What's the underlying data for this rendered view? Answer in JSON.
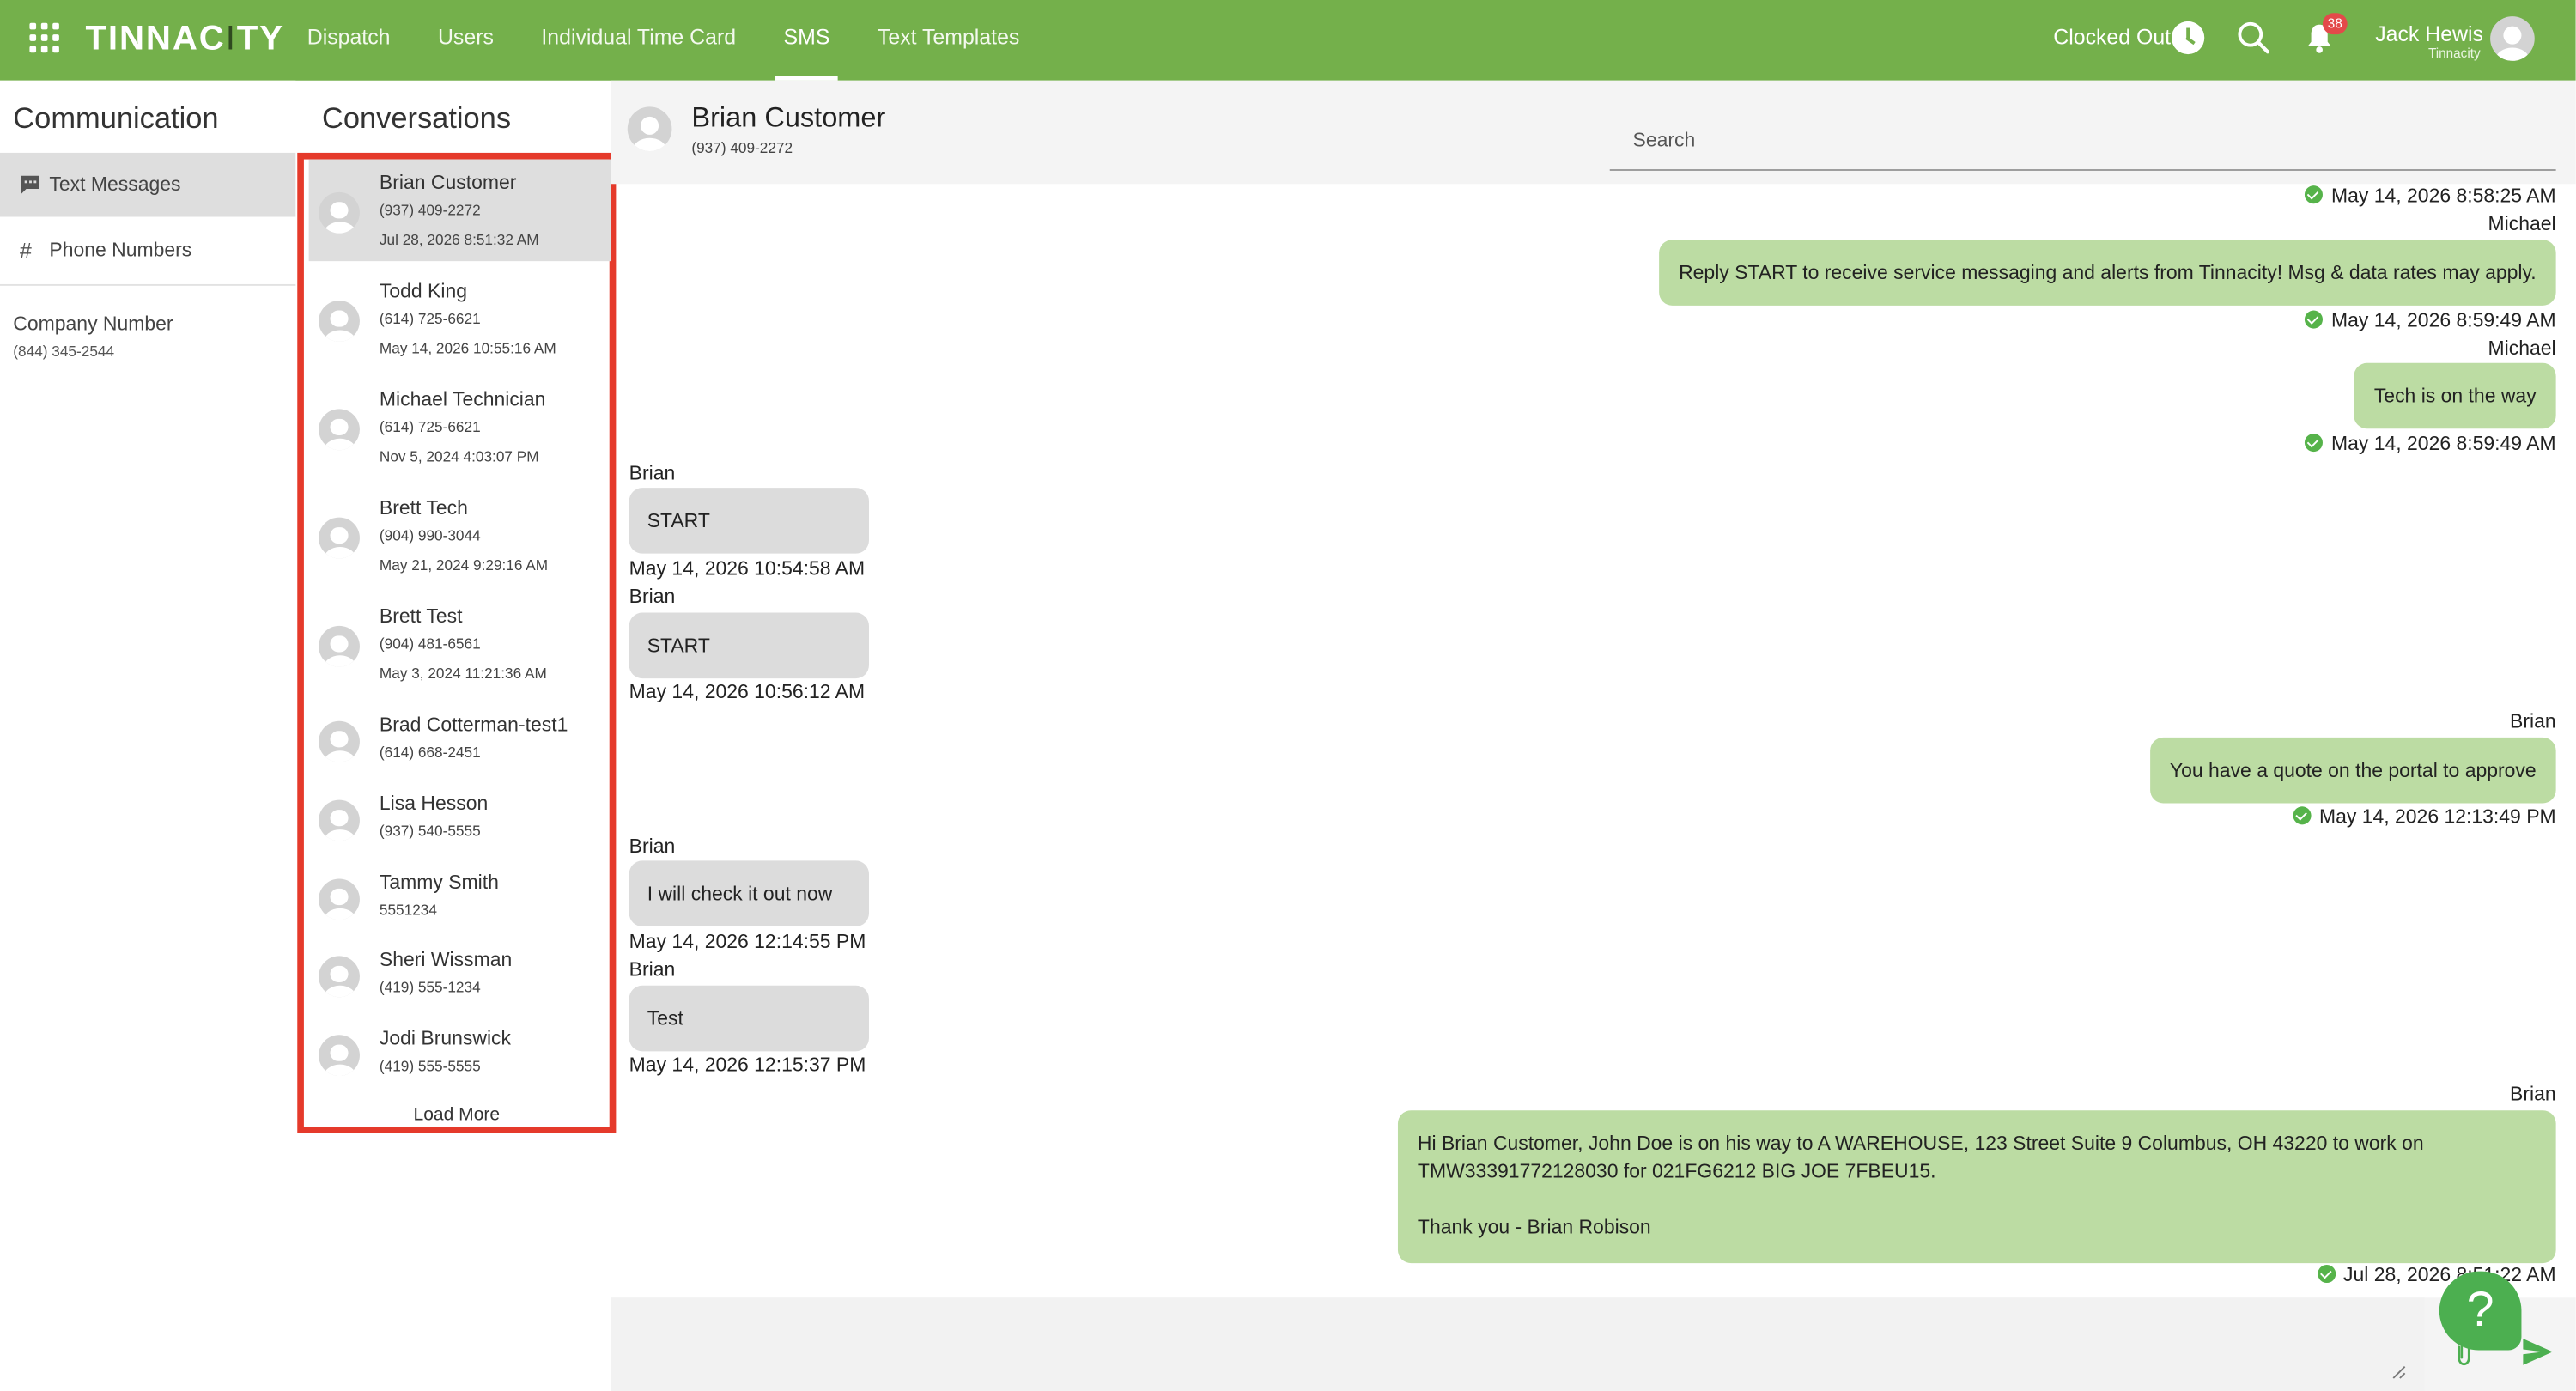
{
  "topbar": {
    "logo": {
      "part1": "TINNAC",
      "part2": "I",
      "part3": "TY"
    },
    "nav": [
      "Dispatch",
      "Users",
      "Individual Time Card",
      "SMS",
      "Text Templates"
    ],
    "active_nav": "SMS",
    "clock_status": "Clocked Out",
    "notifications": "38",
    "user_name": "Jack Hewis",
    "user_org": "Tinnacity",
    "accent_color": "#74b04b"
  },
  "communication": {
    "title": "Communication",
    "items": [
      {
        "label": "Text Messages",
        "icon": "chat-icon"
      },
      {
        "label": "Phone Numbers",
        "icon": "hash-icon"
      }
    ],
    "company_label": "Company Number",
    "company_number": "(844) 345-2544"
  },
  "conversations": {
    "title": "Conversations",
    "items": [
      {
        "name": "Brian Customer",
        "phone": "(937) 409-2272",
        "date": "Jul 28, 2026 8:51:32 AM"
      },
      {
        "name": "Todd King",
        "phone": "(614) 725-6621",
        "date": "May 14, 2026 10:55:16 AM"
      },
      {
        "name": "Michael Technician",
        "phone": "(614) 725-6621",
        "date": "Nov 5, 2024 4:03:07 PM"
      },
      {
        "name": "Brett Tech",
        "phone": "(904) 990-3044",
        "date": "May 21, 2024 9:29:16 AM"
      },
      {
        "name": "Brett Test",
        "phone": "(904) 481-6561",
        "date": "May 3, 2024 11:21:36 AM"
      },
      {
        "name": "Brad Cotterman-test1",
        "phone": "(614) 668-2451",
        "date": ""
      },
      {
        "name": "Lisa Hesson",
        "phone": "(937) 540-5555",
        "date": ""
      },
      {
        "name": "Tammy Smith",
        "phone": "5551234",
        "date": ""
      },
      {
        "name": "Sheri Wissman",
        "phone": "(419) 555-1234",
        "date": ""
      },
      {
        "name": "Jodi Brunswick",
        "phone": "(419) 555-5555",
        "date": ""
      }
    ],
    "load_more": "Load More",
    "highlight_color": "#e53a2b"
  },
  "chat": {
    "name": "Brian Customer",
    "phone": "(937) 409-2272",
    "search_placeholder": "Search",
    "messages": [
      {
        "dir": "status",
        "text": "May 14, 2026 8:58:25 AM"
      },
      {
        "dir": "out",
        "sender": "Michael",
        "text": "Reply START to receive service messaging and alerts from Tinnacity! Msg & data rates may apply.",
        "ts": "May 14, 2026 8:59:49 AM"
      },
      {
        "dir": "out",
        "sender": "Michael",
        "text": "Tech is on the way",
        "ts": "May 14, 2026 8:59:49 AM"
      },
      {
        "dir": "in",
        "sender": "Brian",
        "text": "START",
        "ts": "May 14, 2026 10:54:58 AM"
      },
      {
        "dir": "in",
        "sender": "Brian",
        "text": "START",
        "ts": "May 14, 2026 10:56:12 AM"
      },
      {
        "dir": "out",
        "sender": "Brian",
        "text": "You have a quote on the portal to approve",
        "ts": "May 14, 2026 12:13:49 PM"
      },
      {
        "dir": "in",
        "sender": "Brian",
        "text": "I will check it out now",
        "ts": "May 14, 2026 12:14:55 PM"
      },
      {
        "dir": "in",
        "sender": "Brian",
        "text": "Test",
        "ts": "May 14, 2026 12:15:37 PM"
      },
      {
        "dir": "out",
        "sender": "Brian",
        "lines": [
          "Hi Brian Customer, John Doe is on his way to A WAREHOUSE, 123 Street Suite 9 Columbus, OH 43220 to work on",
          "TMW33391772128030 for 021FG6212 BIG JOE 7FBEU15.",
          "",
          "Thank you - Brian Robison"
        ],
        "ts": "Jul 28, 2026 8:51:22 AM"
      }
    ],
    "bubble_out_color": "#bcdca3",
    "bubble_in_color": "#dcdcdc"
  },
  "help": {
    "label": "?"
  }
}
